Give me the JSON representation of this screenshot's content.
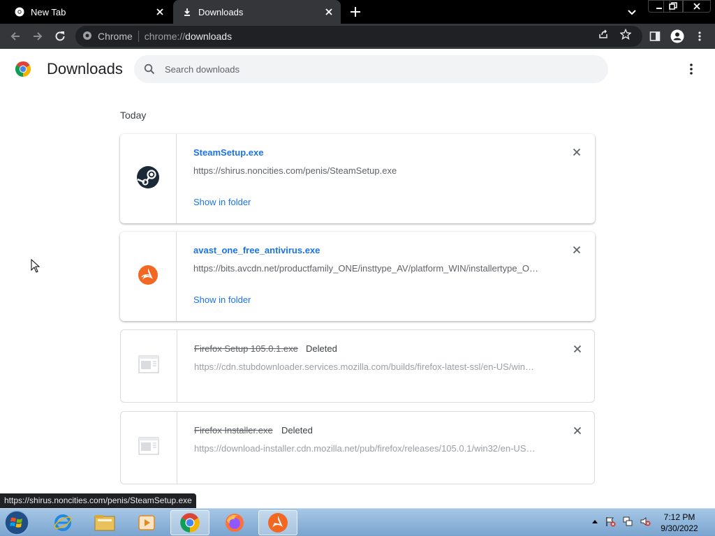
{
  "browser": {
    "tabs": [
      {
        "title": "New Tab",
        "active": false
      },
      {
        "title": "Downloads",
        "active": true
      }
    ],
    "omnibox": {
      "site_label": "Chrome",
      "url_scheme": "chrome://",
      "url_host": "downloads"
    }
  },
  "page": {
    "title": "Downloads",
    "search_placeholder": "Search downloads",
    "section_date": "Today"
  },
  "downloads": [
    {
      "icon": "steam-icon",
      "filename": "SteamSetup.exe",
      "status": "",
      "url": "https://shirus.noncities.com/penis/SteamSetup.exe",
      "action": "Show in folder"
    },
    {
      "icon": "avast-icon",
      "filename": "avast_one_free_antivirus.exe",
      "status": "",
      "url": "https://bits.avcdn.net/productfamily_ONE/insttype_AV/platform_WIN/installertype_O…",
      "action": "Show in folder"
    },
    {
      "icon": "generic-file-icon",
      "filename": "Firefox Setup 105.0.1.exe",
      "status": "Deleted",
      "url": "https://cdn.stubdownloader.services.mozilla.com/builds/firefox-latest-ssl/en-US/win…",
      "action": ""
    },
    {
      "icon": "generic-file-icon",
      "filename": "Firefox Installer.exe",
      "status": "Deleted",
      "url": "https://download-installer.cdn.mozilla.net/pub/firefox/releases/105.0.1/win32/en-US…",
      "action": ""
    }
  ],
  "status_bar": {
    "hover_url": "https://shirus.noncities.com/penis/SteamSetup.exe"
  },
  "taskbar": {
    "apps": [
      "internet-explorer-icon",
      "file-explorer-icon",
      "media-player-icon",
      "chrome-icon",
      "firefox-icon",
      "avast-icon"
    ],
    "clock_time": "7:12 PM",
    "clock_date": "9/30/2022"
  },
  "colors": {
    "link_blue": "#1a73e8",
    "toolbar_bg": "#35363a",
    "tabstrip_bg": "#000000",
    "avast_orange": "#f26722",
    "steam_navy": "#1b2838"
  }
}
